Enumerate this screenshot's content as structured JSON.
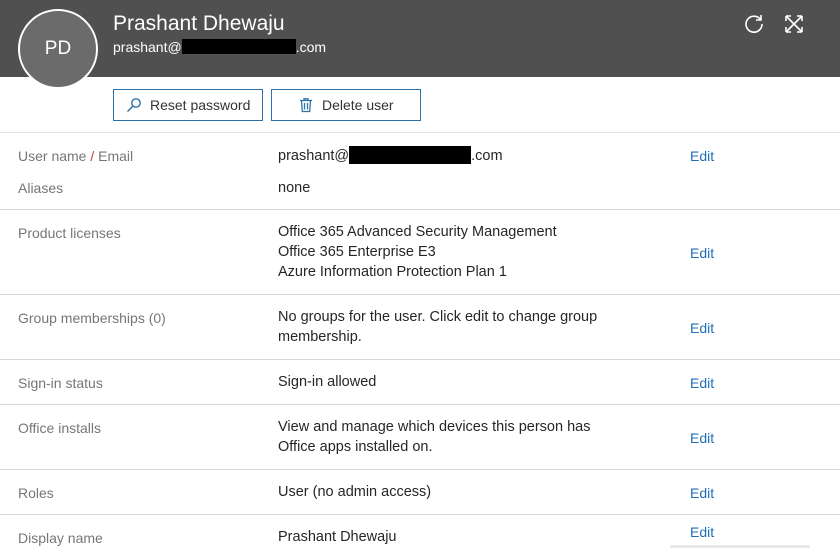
{
  "header": {
    "initials": "PD",
    "name": "Prashant Dhewaju",
    "email_prefix": "prashant@",
    "email_suffix": ".com",
    "refresh_icon": "refresh-icon",
    "close_icon": "close-icon",
    "background_color": "#505050"
  },
  "actions": {
    "reset_password_label": "Reset password",
    "delete_user_label": "Delete user",
    "reset_icon": "search-icon",
    "delete_icon": "trash-icon"
  },
  "details": {
    "username": {
      "label_part1": "User name ",
      "label_slash": "/",
      "label_part2": " Email",
      "value_prefix": "prashant@",
      "value_suffix": ".com",
      "edit": "Edit"
    },
    "aliases": {
      "label": "Aliases",
      "value": "none"
    },
    "licenses": {
      "label": "Product licenses",
      "values": [
        "Office 365 Advanced Security Management",
        "Office 365 Enterprise E3",
        "Azure Information Protection Plan 1"
      ],
      "edit": "Edit"
    },
    "groups": {
      "label": "Group memberships (0)",
      "value": "No groups for the user. Click edit to change group membership.",
      "edit": "Edit"
    },
    "signin": {
      "label": "Sign-in status",
      "value": "Sign-in allowed",
      "edit": "Edit"
    },
    "office": {
      "label": "Office installs",
      "value": "View and manage which devices this person has Office apps installed on.",
      "edit": "Edit"
    },
    "roles": {
      "label": "Roles",
      "value": "User (no admin access)",
      "edit": "Edit"
    },
    "display_name": {
      "label": "Display name",
      "value": "Prashant Dhewaju",
      "edit": "Edit"
    }
  },
  "colors": {
    "link": "#1f6fb7",
    "button_border": "#2c72a8",
    "label": "#767676"
  }
}
